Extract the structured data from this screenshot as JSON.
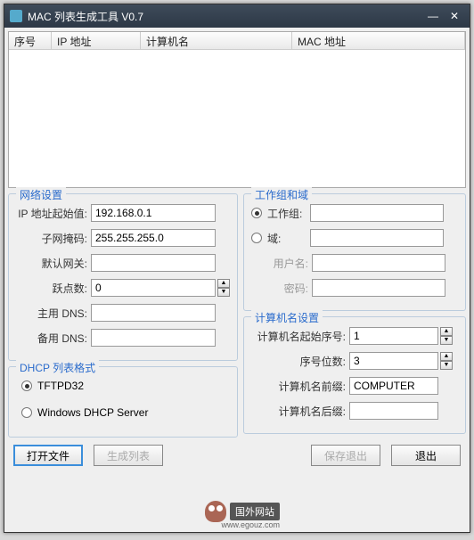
{
  "title": "MAC 列表生成工具 V0.7",
  "columns": {
    "seq": "序号",
    "ip": "IP 地址",
    "host": "计算机名",
    "mac": "MAC 地址"
  },
  "net": {
    "legend": "网络设置",
    "ip_start_label": "IP 地址起始值:",
    "ip_start": "192.168.0.1",
    "mask_label": "子网掩码:",
    "mask": "255.255.255.0",
    "gateway_label": "默认网关:",
    "gateway": "",
    "hops_label": "跃点数:",
    "hops": "0",
    "dns1_label": "主用 DNS:",
    "dns1": "",
    "dns2_label": "备用 DNS:",
    "dns2": ""
  },
  "dhcp": {
    "legend": "DHCP 列表格式",
    "opt1": "TFTPD32",
    "opt2": "Windows DHCP Server"
  },
  "wg": {
    "legend": "工作组和域",
    "workgroup_label": "工作组:",
    "workgroup": "",
    "domain_label": "域:",
    "domain": "",
    "user_label": "用户名:",
    "user": "",
    "pass_label": "密码:",
    "pass": ""
  },
  "cn": {
    "legend": "计算机名设置",
    "start_seq_label": "计算机名起始序号:",
    "start_seq": "1",
    "digits_label": "序号位数:",
    "digits": "3",
    "prefix_label": "计算机名前缀:",
    "prefix": "COMPUTER",
    "suffix_label": "计算机名后缀:",
    "suffix": ""
  },
  "buttons": {
    "open": "打开文件",
    "gen": "生成列表",
    "save": "保存退出",
    "exit": "退出"
  },
  "watermark": {
    "text": "国外网站",
    "url": "www.egouz.com"
  }
}
